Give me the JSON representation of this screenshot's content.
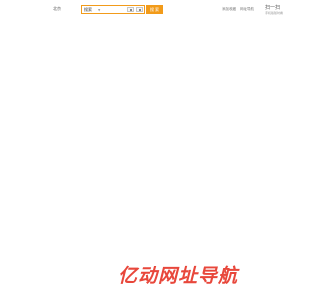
{
  "header": {
    "city": "北京",
    "search": {
      "type_label": "搜索",
      "placeholder": "",
      "value": "",
      "button_label": "搜 索"
    },
    "links": [
      "添加收藏",
      "网址导航"
    ],
    "promo": {
      "title": "扫一扫",
      "subtitle": "手机版随时看"
    }
  },
  "logo": {
    "text": "亿动网址导航"
  },
  "colors": {
    "accent": "#f29b1a",
    "brand": "#e8473b"
  }
}
